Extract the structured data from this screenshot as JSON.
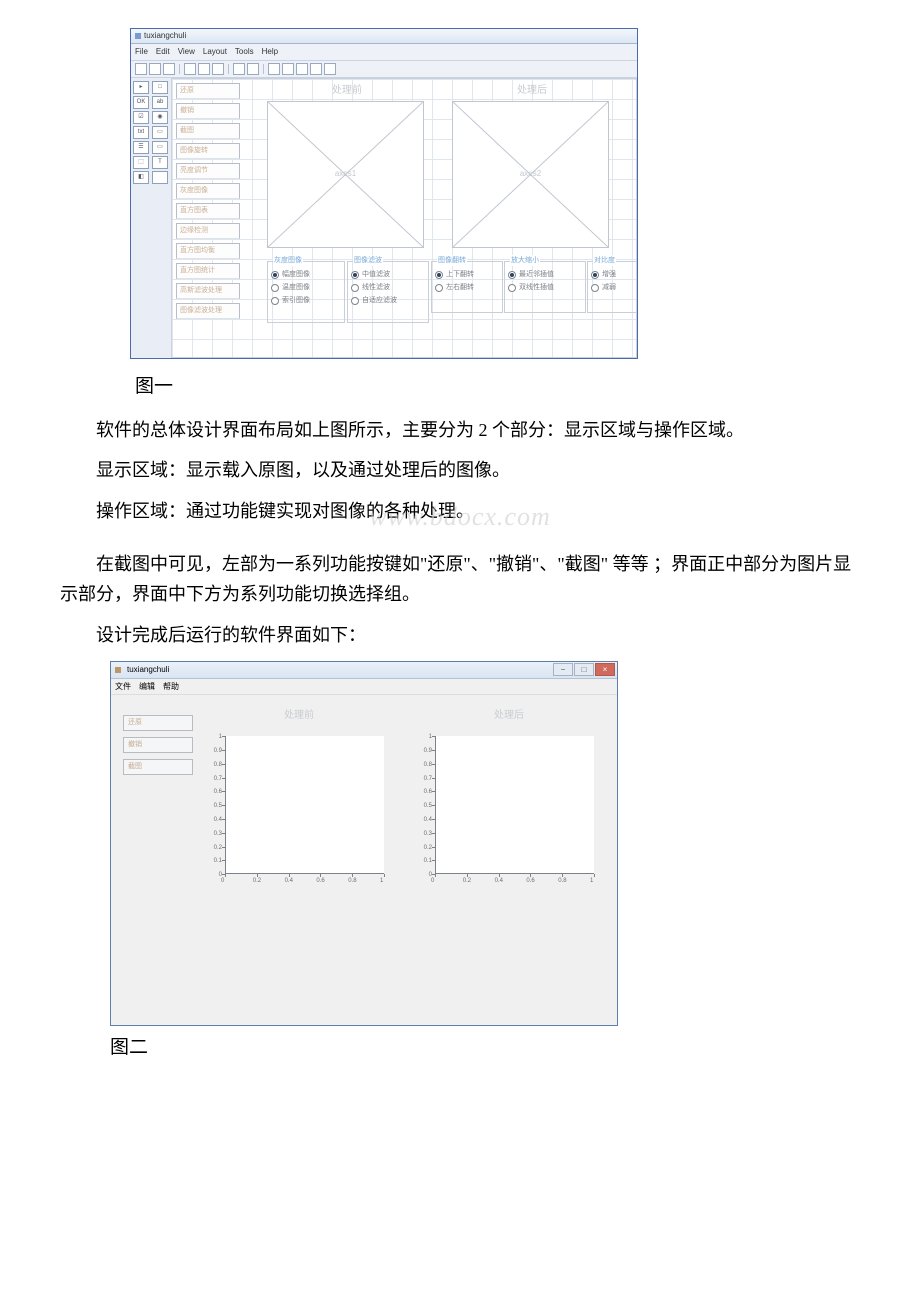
{
  "watermark": "www.bdocx.com",
  "captions": {
    "fig1": "图一",
    "fig2": "图二"
  },
  "paragraphs": {
    "p1": "软件的总体设计界面布局如上图所示，主要分为 2 个部分：显示区域与操作区域。",
    "p2": "显示区域：显示载入原图，以及通过处理后的图像。",
    "p3": "操作区域：通过功能键实现对图像的各种处理。",
    "p4": "在截图中可见，左部为一系列功能按键如\"还原\"、\"撤销\"、\"截图\" 等等 ；界面正中部分为图片显示部分，界面中下方为系列功能切换选择组。",
    "p5": "设计完成后运行的软件界面如下："
  },
  "guide_window": {
    "title": "tuxiangchuli",
    "menus": [
      "File",
      "Edit",
      "View",
      "Layout",
      "Tools",
      "Help"
    ],
    "palette": [
      "▸",
      "□",
      "OK",
      "ab",
      "☑",
      "◉",
      "txt",
      "▭",
      "☰",
      "▭",
      "⬚",
      "T",
      "◧",
      ""
    ],
    "buttons": [
      "还原",
      "撤销",
      "截图",
      "图像旋转",
      "亮度调节",
      "灰度图像",
      "直方图表",
      "边缘检测",
      "直方图均衡",
      "直方图统计",
      "高斯滤波处理",
      "图像滤波处理"
    ],
    "panels": {
      "left": {
        "title": "处理前",
        "axes_label": "axes1"
      },
      "right": {
        "title": "处理后",
        "axes_label": "axes2"
      }
    },
    "option_groups": [
      {
        "legend": "灰度图像",
        "opts": [
          "幅度图像",
          "温度图像",
          "索引图像"
        ],
        "sel": 0
      },
      {
        "legend": "图像滤波",
        "opts": [
          "中值滤波",
          "线性滤波",
          "自适应滤波"
        ],
        "sel": 0
      },
      {
        "legend": "图像翻转",
        "opts": [
          "上下翻转",
          "左右翻转"
        ],
        "sel": 0
      },
      {
        "legend": "放大缩小",
        "opts": [
          "最近邻插值",
          "双线性插值"
        ],
        "sel": 0
      },
      {
        "legend": "对比度",
        "opts": [
          "增强",
          "减弱"
        ],
        "sel": 0
      }
    ]
  },
  "run_window": {
    "title": "tuxiangchuli",
    "menus": [
      "文件",
      "编辑",
      "帮助"
    ],
    "buttons": [
      "还原",
      "撤销",
      "截图"
    ],
    "panels": {
      "left_title": "处理前",
      "right_title": "处理后"
    }
  },
  "chart_data": [
    {
      "type": "line",
      "title": "处理前",
      "series": [],
      "xlim": [
        0,
        1
      ],
      "ylim": [
        0,
        1
      ],
      "xticks": [
        0,
        0.2,
        0.4,
        0.6,
        0.8,
        1
      ],
      "yticks": [
        0,
        0.1,
        0.2,
        0.3,
        0.4,
        0.5,
        0.6,
        0.7,
        0.8,
        0.9,
        1
      ],
      "xlabel": "",
      "ylabel": ""
    },
    {
      "type": "line",
      "title": "处理后",
      "series": [],
      "xlim": [
        0,
        1
      ],
      "ylim": [
        0,
        1
      ],
      "xticks": [
        0,
        0.2,
        0.4,
        0.6,
        0.8,
        1
      ],
      "yticks": [
        0,
        0.1,
        0.2,
        0.3,
        0.4,
        0.5,
        0.6,
        0.7,
        0.8,
        0.9,
        1
      ],
      "xlabel": "",
      "ylabel": ""
    }
  ]
}
